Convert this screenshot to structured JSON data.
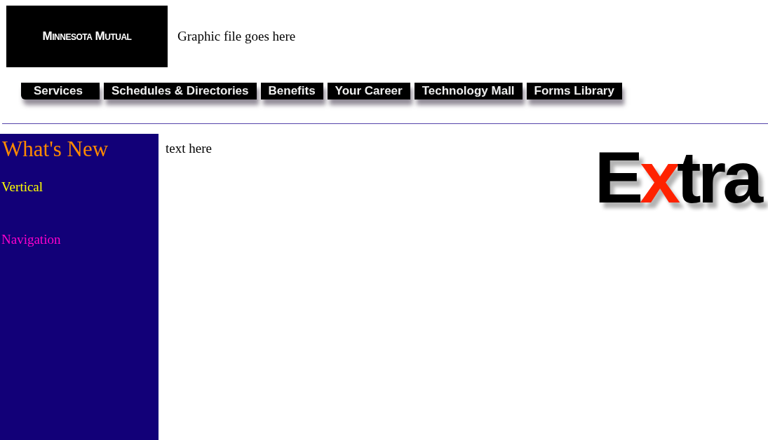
{
  "header": {
    "logo": "Minnesota Mutual",
    "placeholder_text": "Graphic file goes here"
  },
  "nav": [
    {
      "label": "Services"
    },
    {
      "label": "Schedules & Directories"
    },
    {
      "label": "Benefits"
    },
    {
      "label": "Your Career"
    },
    {
      "label": "Technology Mall"
    },
    {
      "label": "Forms Library"
    }
  ],
  "sidebar": {
    "title": "What's New",
    "items": [
      {
        "label": "Vertical",
        "color": "#ffff00"
      },
      {
        "label": "Navigation",
        "color": "#ff00cc"
      }
    ]
  },
  "content": {
    "text": "text here"
  },
  "extra_logo": {
    "parts": [
      {
        "text": "E",
        "color": "#000000"
      },
      {
        "text": "x",
        "color": "#ff2200"
      },
      {
        "text": "tra",
        "color": "#000000"
      }
    ]
  }
}
